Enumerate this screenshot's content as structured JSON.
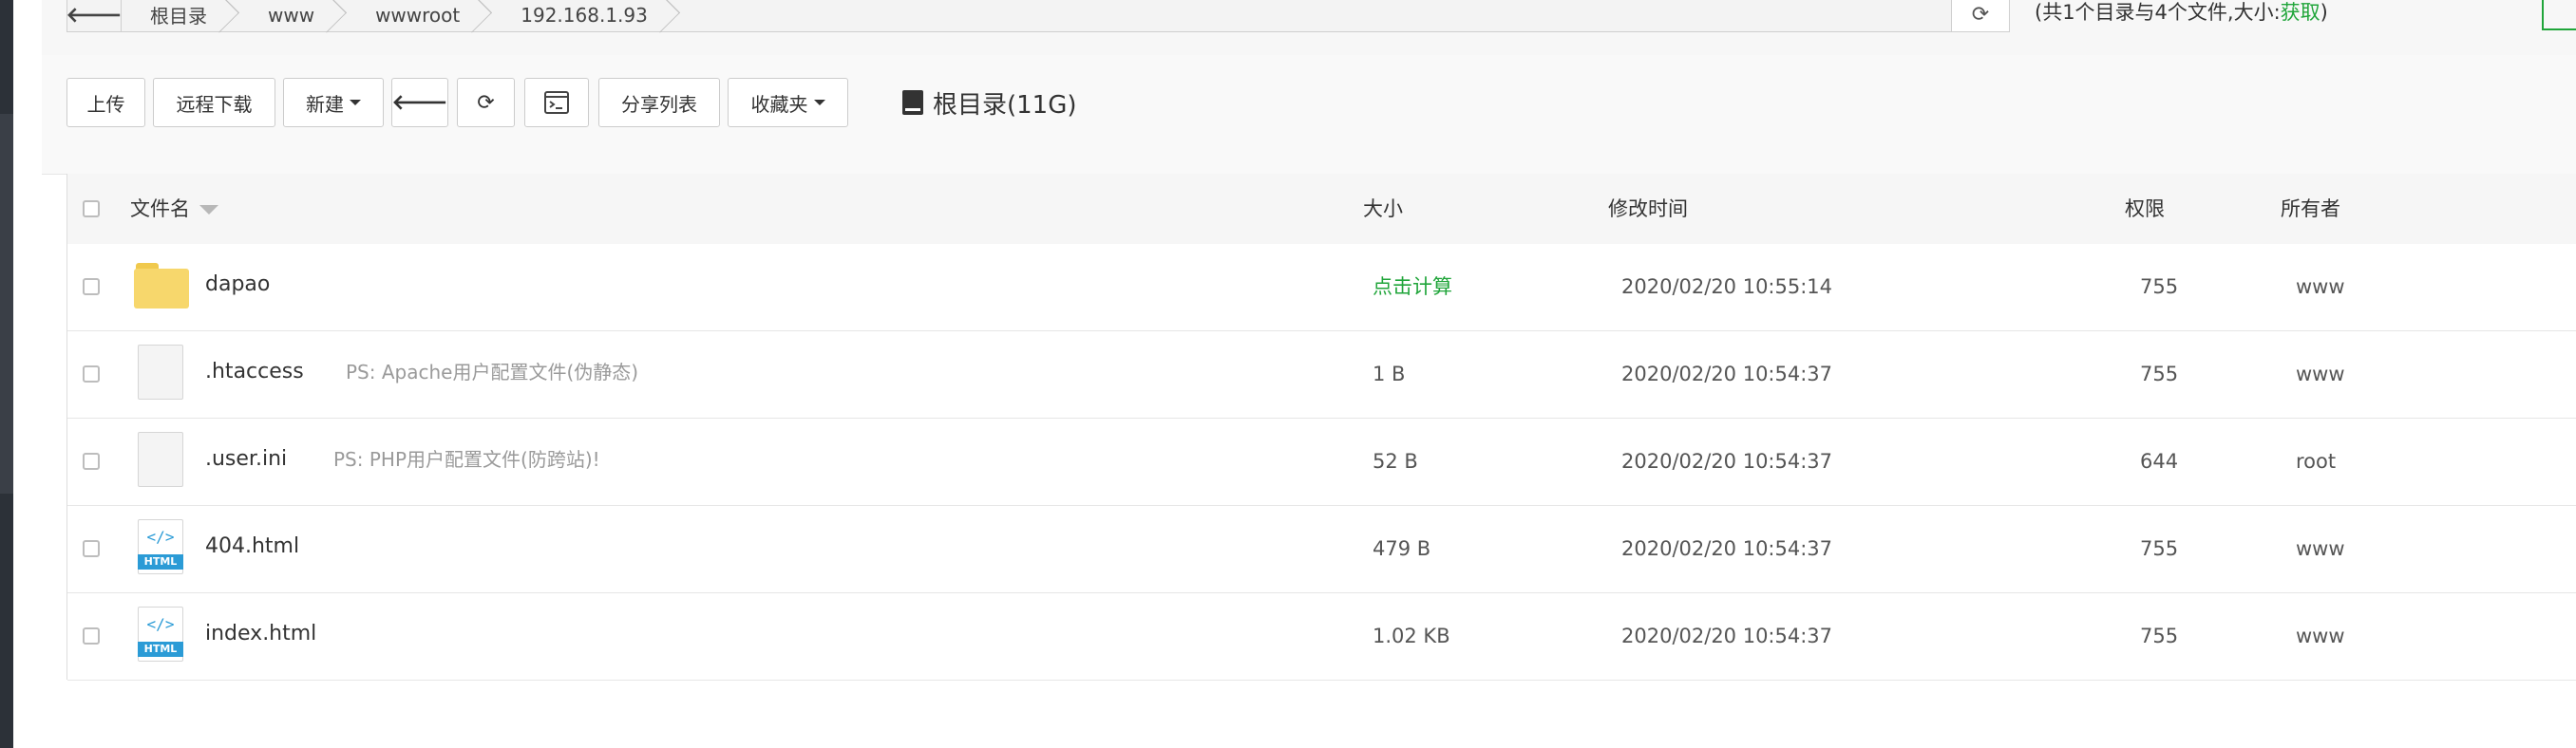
{
  "breadcrumb": {
    "back_icon": "arrow-left-icon",
    "items": [
      "根目录",
      "www",
      "wwwroot",
      "192.168.1.93"
    ],
    "refresh_icon": "refresh-icon"
  },
  "summary": {
    "prefix": "(共1个目录与4个文件,大小:",
    "link": "获取",
    "suffix": ")"
  },
  "toolbar": {
    "upload": "上传",
    "remote_download": "远程下载",
    "new": "新建",
    "back_icon": "arrow-left-icon",
    "refresh_icon": "refresh-icon",
    "terminal_icon": "terminal-icon",
    "share_list": "分享列表",
    "favorites": "收藏夹"
  },
  "disk": {
    "icon": "hdd-icon",
    "label": "根目录(11G)"
  },
  "table": {
    "headers": {
      "filename": "文件名",
      "size": "大小",
      "modified": "修改时间",
      "permission": "权限",
      "owner": "所有者"
    },
    "rows": [
      {
        "icon": "folder-icon",
        "name": "dapao",
        "note": "",
        "size": "点击计算",
        "modified": "2020/02/20 10:55:14",
        "perm": "755",
        "owner": "www"
      },
      {
        "icon": "file-icon",
        "name": ".htaccess",
        "note": "PS: Apache用户配置文件(伪静态)",
        "size": "1 B",
        "modified": "2020/02/20 10:54:37",
        "perm": "755",
        "owner": "www"
      },
      {
        "icon": "file-icon",
        "name": ".user.ini",
        "note": "PS: PHP用户配置文件(防跨站)!",
        "size": "52 B",
        "modified": "2020/02/20 10:54:37",
        "perm": "644",
        "owner": "root"
      },
      {
        "icon": "html-file-icon",
        "name": "404.html",
        "note": "",
        "size": "479 B",
        "modified": "2020/02/20 10:54:37",
        "perm": "755",
        "owner": "www"
      },
      {
        "icon": "html-file-icon",
        "name": "index.html",
        "note": "",
        "size": "1.02 KB",
        "modified": "2020/02/20 10:54:37",
        "perm": "755",
        "owner": "www"
      }
    ],
    "html_badge": "HTML"
  },
  "colors": {
    "accent_green": "#20a53a",
    "folder_yellow": "#f7d76c",
    "html_blue": "#2b9bd6"
  }
}
